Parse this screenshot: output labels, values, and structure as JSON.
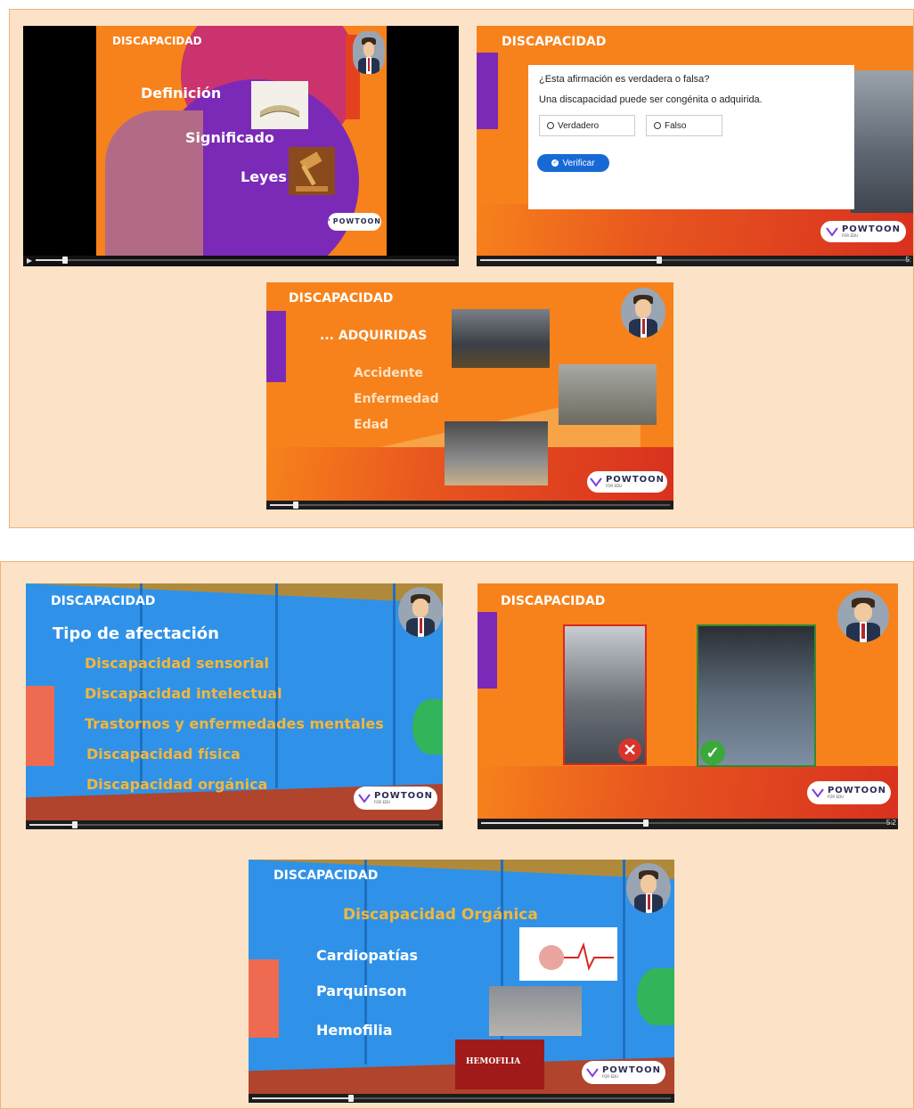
{
  "panels": [
    {
      "slides": [
        {
          "title": "DISCAPACIDAD",
          "items": [
            "Definición",
            "Significado",
            "Leyes"
          ]
        },
        {
          "title": "DISCAPACIDAD",
          "quiz": {
            "question": "¿Esta afirmación es verdadera o falsa?",
            "statement": "Una discapacidad puede ser congénita o adquirida.",
            "option_true": "Verdadero",
            "option_false": "Falso",
            "verify_label": "Verificar",
            "time_fragment": "5:"
          }
        },
        {
          "title": "DISCAPACIDAD",
          "heading": "... ADQUIRIDAS",
          "items": [
            "Accidente",
            "Enfermedad",
            "Edad"
          ]
        }
      ]
    },
    {
      "slides": [
        {
          "title": "DISCAPACIDAD",
          "subtitle": "Tipo de afectación",
          "items": [
            "Discapacidad sensorial",
            "Discapacidad intelectual",
            "Trastornos y enfermedades mentales",
            "Discapacidad física",
            "Discapacidad orgánica"
          ]
        },
        {
          "title": "DISCAPACIDAD",
          "time_fragment": "5:2"
        },
        {
          "title": "DISCAPACIDAD",
          "heading": "Discapacidad Orgánica",
          "items": [
            "Cardiopatías",
            "Parquinson",
            "Hemofilia"
          ],
          "image_caption": "HEMOFILIA"
        }
      ]
    }
  ],
  "logo": {
    "brand": "POWTOON",
    "sub": "FOR EDU"
  },
  "colors": {
    "orange": "#f7821b",
    "blue": "#2f92e8",
    "yellow_text": "#f4b63a",
    "purple": "#7b2ab8",
    "panel_bg": "#fce3c8"
  },
  "icons": [
    "play-icon",
    "check-circle-icon",
    "cross-icon",
    "check-icon",
    "book-icon",
    "gavel-icon"
  ]
}
